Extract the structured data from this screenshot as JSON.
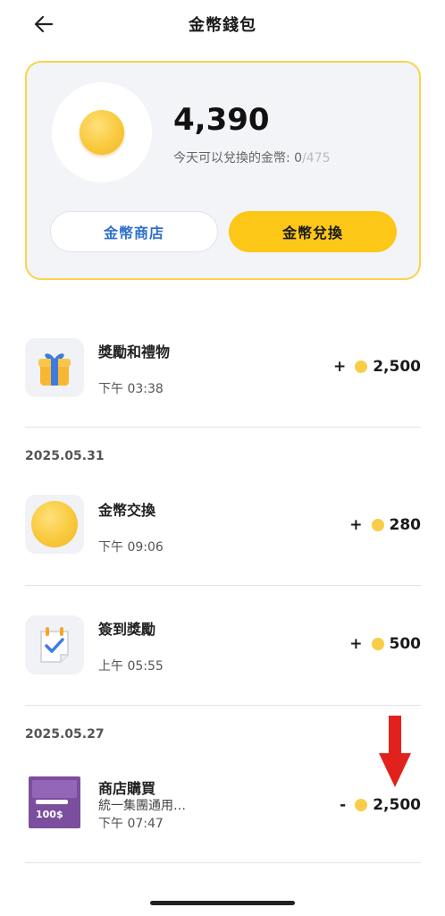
{
  "header": {
    "title": "金幣錢包",
    "back_icon": "arrow-left-icon"
  },
  "wallet": {
    "balance": "4,390",
    "exchange_label": "今天可以兌換的金幣: ",
    "exchange_used": "0",
    "exchange_limit": "/475",
    "shop_button": "金幣商店",
    "exchange_button": "金幣兌換",
    "accent_color": "#fcc716",
    "border_color": "#f6d54a",
    "link_color": "#2f6fce"
  },
  "transactions": [
    {
      "title": "獎勵和禮物",
      "time": "下午 03:38",
      "sign": "+",
      "amount": "2,500",
      "icon": "gift-box-icon"
    },
    {
      "date": "2025.05.31",
      "title": "金幣交換",
      "time": "下午 09:06",
      "sign": "+",
      "amount": "280",
      "icon": "coin-icon"
    },
    {
      "title": "簽到獎勵",
      "time": "上午 05:55",
      "sign": "+",
      "amount": "500",
      "icon": "calendar-check-icon"
    },
    {
      "date": "2025.05.27",
      "title": "商店購買",
      "subtitle": "統一集團通用…",
      "time": "下午 07:47",
      "sign": "-",
      "amount": "2,500",
      "icon": "voucher-icon",
      "voucher_value": "100$"
    }
  ],
  "annotation": {
    "icon": "red-down-arrow-icon",
    "color": "#e3211c"
  }
}
